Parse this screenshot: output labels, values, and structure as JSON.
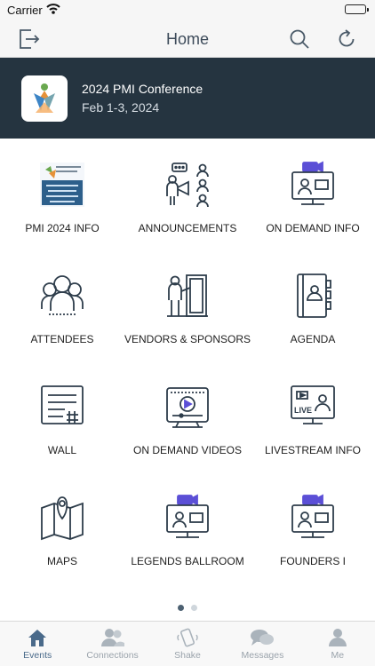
{
  "status": {
    "carrier": "Carrier"
  },
  "header": {
    "title": "Home"
  },
  "event": {
    "title": "2024 PMI Conference",
    "dates": "Feb 1-3, 2024"
  },
  "tiles": [
    {
      "label": "PMI 2024 INFO",
      "icon": "pmi-logo-icon"
    },
    {
      "label": "ANNOUNCEMENTS",
      "icon": "megaphone-presenter-icon"
    },
    {
      "label": "ON DEMAND INFO",
      "icon": "video-monitor-icon"
    },
    {
      "label": "ATTENDEES",
      "icon": "group-people-icon"
    },
    {
      "label": "VENDORS & SPONSORS",
      "icon": "person-at-door-icon"
    },
    {
      "label": "AGENDA",
      "icon": "address-book-icon"
    },
    {
      "label": "WALL",
      "icon": "notes-hashtag-icon"
    },
    {
      "label": "ON DEMAND VIDEOS",
      "icon": "video-player-icon"
    },
    {
      "label": "LIVESTREAM INFO",
      "icon": "livestream-monitor-icon"
    },
    {
      "label": "MAPS",
      "icon": "map-pin-icon"
    },
    {
      "label": "LEGENDS BALLROOM",
      "icon": "video-monitor-icon"
    },
    {
      "label": "FOUNDERS I",
      "icon": "video-monitor-icon"
    }
  ],
  "tabs": [
    {
      "label": "Events",
      "active": true
    },
    {
      "label": "Connections",
      "active": false
    },
    {
      "label": "Shake",
      "active": false
    },
    {
      "label": "Messages",
      "active": false
    },
    {
      "label": "Me",
      "active": false
    }
  ],
  "colors": {
    "banner": "#253440",
    "accent_video": "#5b4fd6",
    "icon_stroke": "#2e3d4b",
    "active_tab": "#4a6a8a"
  }
}
